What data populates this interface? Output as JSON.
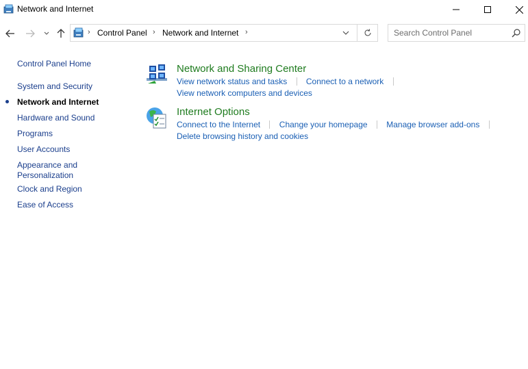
{
  "window": {
    "title": "Network and Internet",
    "icon": "network-folder-icon"
  },
  "nav": {
    "breadcrumbs": [
      "Control Panel",
      "Network and Internet"
    ],
    "search_placeholder": "Search Control Panel"
  },
  "sidebar": {
    "items": [
      {
        "label": "Control Panel Home"
      },
      {
        "label": "System and Security"
      },
      {
        "label": "Network and Internet",
        "active": true
      },
      {
        "label": "Hardware and Sound"
      },
      {
        "label": "Programs"
      },
      {
        "label": "User Accounts"
      },
      {
        "label": "Appearance and Personalization"
      },
      {
        "label": "Clock and Region"
      },
      {
        "label": "Ease of Access"
      }
    ]
  },
  "categories": [
    {
      "title": "Network and Sharing Center",
      "icon": "network-sharing-icon",
      "tasks": [
        "View network status and tasks",
        "Connect to a network",
        "View network computers and devices"
      ]
    },
    {
      "title": "Internet Options",
      "icon": "internet-options-icon",
      "tasks": [
        "Connect to the Internet",
        "Change your homepage",
        "Manage browser add-ons",
        "Delete browsing history and cookies"
      ]
    }
  ],
  "colors": {
    "category_title": "#1e7b1e",
    "task_link": "#1a5fb4",
    "sidebar_link": "#1a3e8c"
  }
}
